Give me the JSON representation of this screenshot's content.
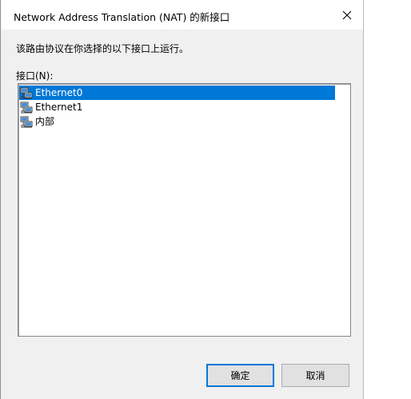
{
  "window": {
    "title": "Network Address Translation (NAT) 的新接口",
    "close_icon": "close-icon"
  },
  "description": "该路由协议在你选择的以下接口上运行。",
  "interfaces_label": "接口(N):",
  "interfaces": [
    {
      "label": "Ethernet0",
      "icon": "network-adapter-icon",
      "selected": true
    },
    {
      "label": "Ethernet1",
      "icon": "network-adapter-icon",
      "selected": false
    },
    {
      "label": "内部",
      "icon": "network-adapter-icon",
      "selected": false
    }
  ],
  "buttons": {
    "ok_label": "确定",
    "cancel_label": "取消"
  },
  "colors": {
    "selection": "#0078d7",
    "dialog_background": "#f0f0f0"
  }
}
